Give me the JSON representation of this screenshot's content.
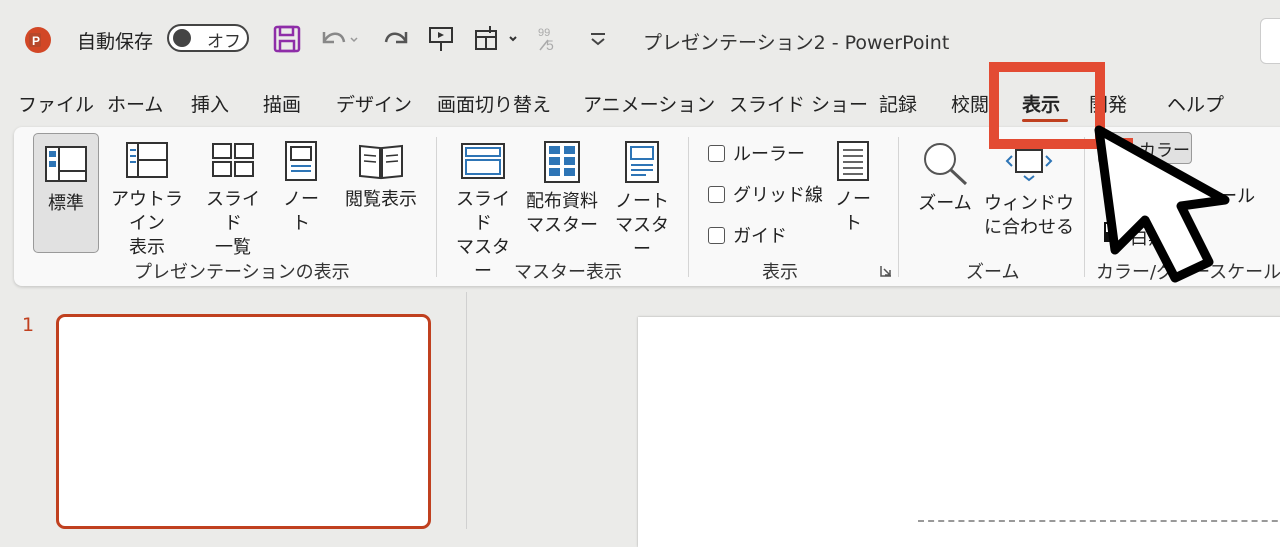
{
  "titlebar": {
    "autosave_label": "自動保存",
    "autosave_state": "オフ",
    "doc_title": "プレゼンテーション2  -  PowerPoint",
    "icons": [
      "app-logo-icon",
      "save-icon",
      "undo-icon",
      "redo-icon",
      "present-icon",
      "insert-icon",
      "format-painter-icon",
      "customize-qat-icon"
    ],
    "brand_color": "#c0401f"
  },
  "tabs": [
    {
      "label": "ファイル"
    },
    {
      "label": "ホーム"
    },
    {
      "label": "挿入"
    },
    {
      "label": "描画"
    },
    {
      "label": "デザイン"
    },
    {
      "label": "画面切り替え"
    },
    {
      "label": "アニメーション"
    },
    {
      "label": "スライド ショー"
    },
    {
      "label": "記録"
    },
    {
      "label": "校閲"
    },
    {
      "label": "表示",
      "active": true
    },
    {
      "label": "開発"
    },
    {
      "label": "ヘルプ"
    }
  ],
  "ribbon": {
    "presentation_views": {
      "group_label": "プレゼンテーションの表示",
      "normal": "標準",
      "outline_1": "アウトライン",
      "outline_2": "表示",
      "sorter_1": "スライド",
      "sorter_2": "一覧",
      "notes_1": "ノー",
      "notes_2": "ト",
      "reading": "閲覧表示"
    },
    "master_views": {
      "group_label": "マスター表示",
      "slide_master_1": "スライド",
      "slide_master_2": "マスター",
      "handout_master_1": "配布資料",
      "handout_master_2": "マスター",
      "notes_master_1": "ノート",
      "notes_master_2": "マスター"
    },
    "show": {
      "group_label": "表示",
      "ruler": "ルーラー",
      "gridlines": "グリッド線",
      "guides": "ガイド",
      "notes_1": "ノー",
      "notes_2": "ト"
    },
    "zoom": {
      "group_label": "ズーム",
      "zoom": "ズーム",
      "fit_1": "ウィンドウ",
      "fit_2": "に合わせる"
    },
    "color": {
      "group_label": "カラー/グレースケール",
      "color": "カラー",
      "grayscale": "グレースケール",
      "bw": "白黒"
    }
  },
  "slides": {
    "number": "1"
  },
  "accent_color": "#e34b33"
}
